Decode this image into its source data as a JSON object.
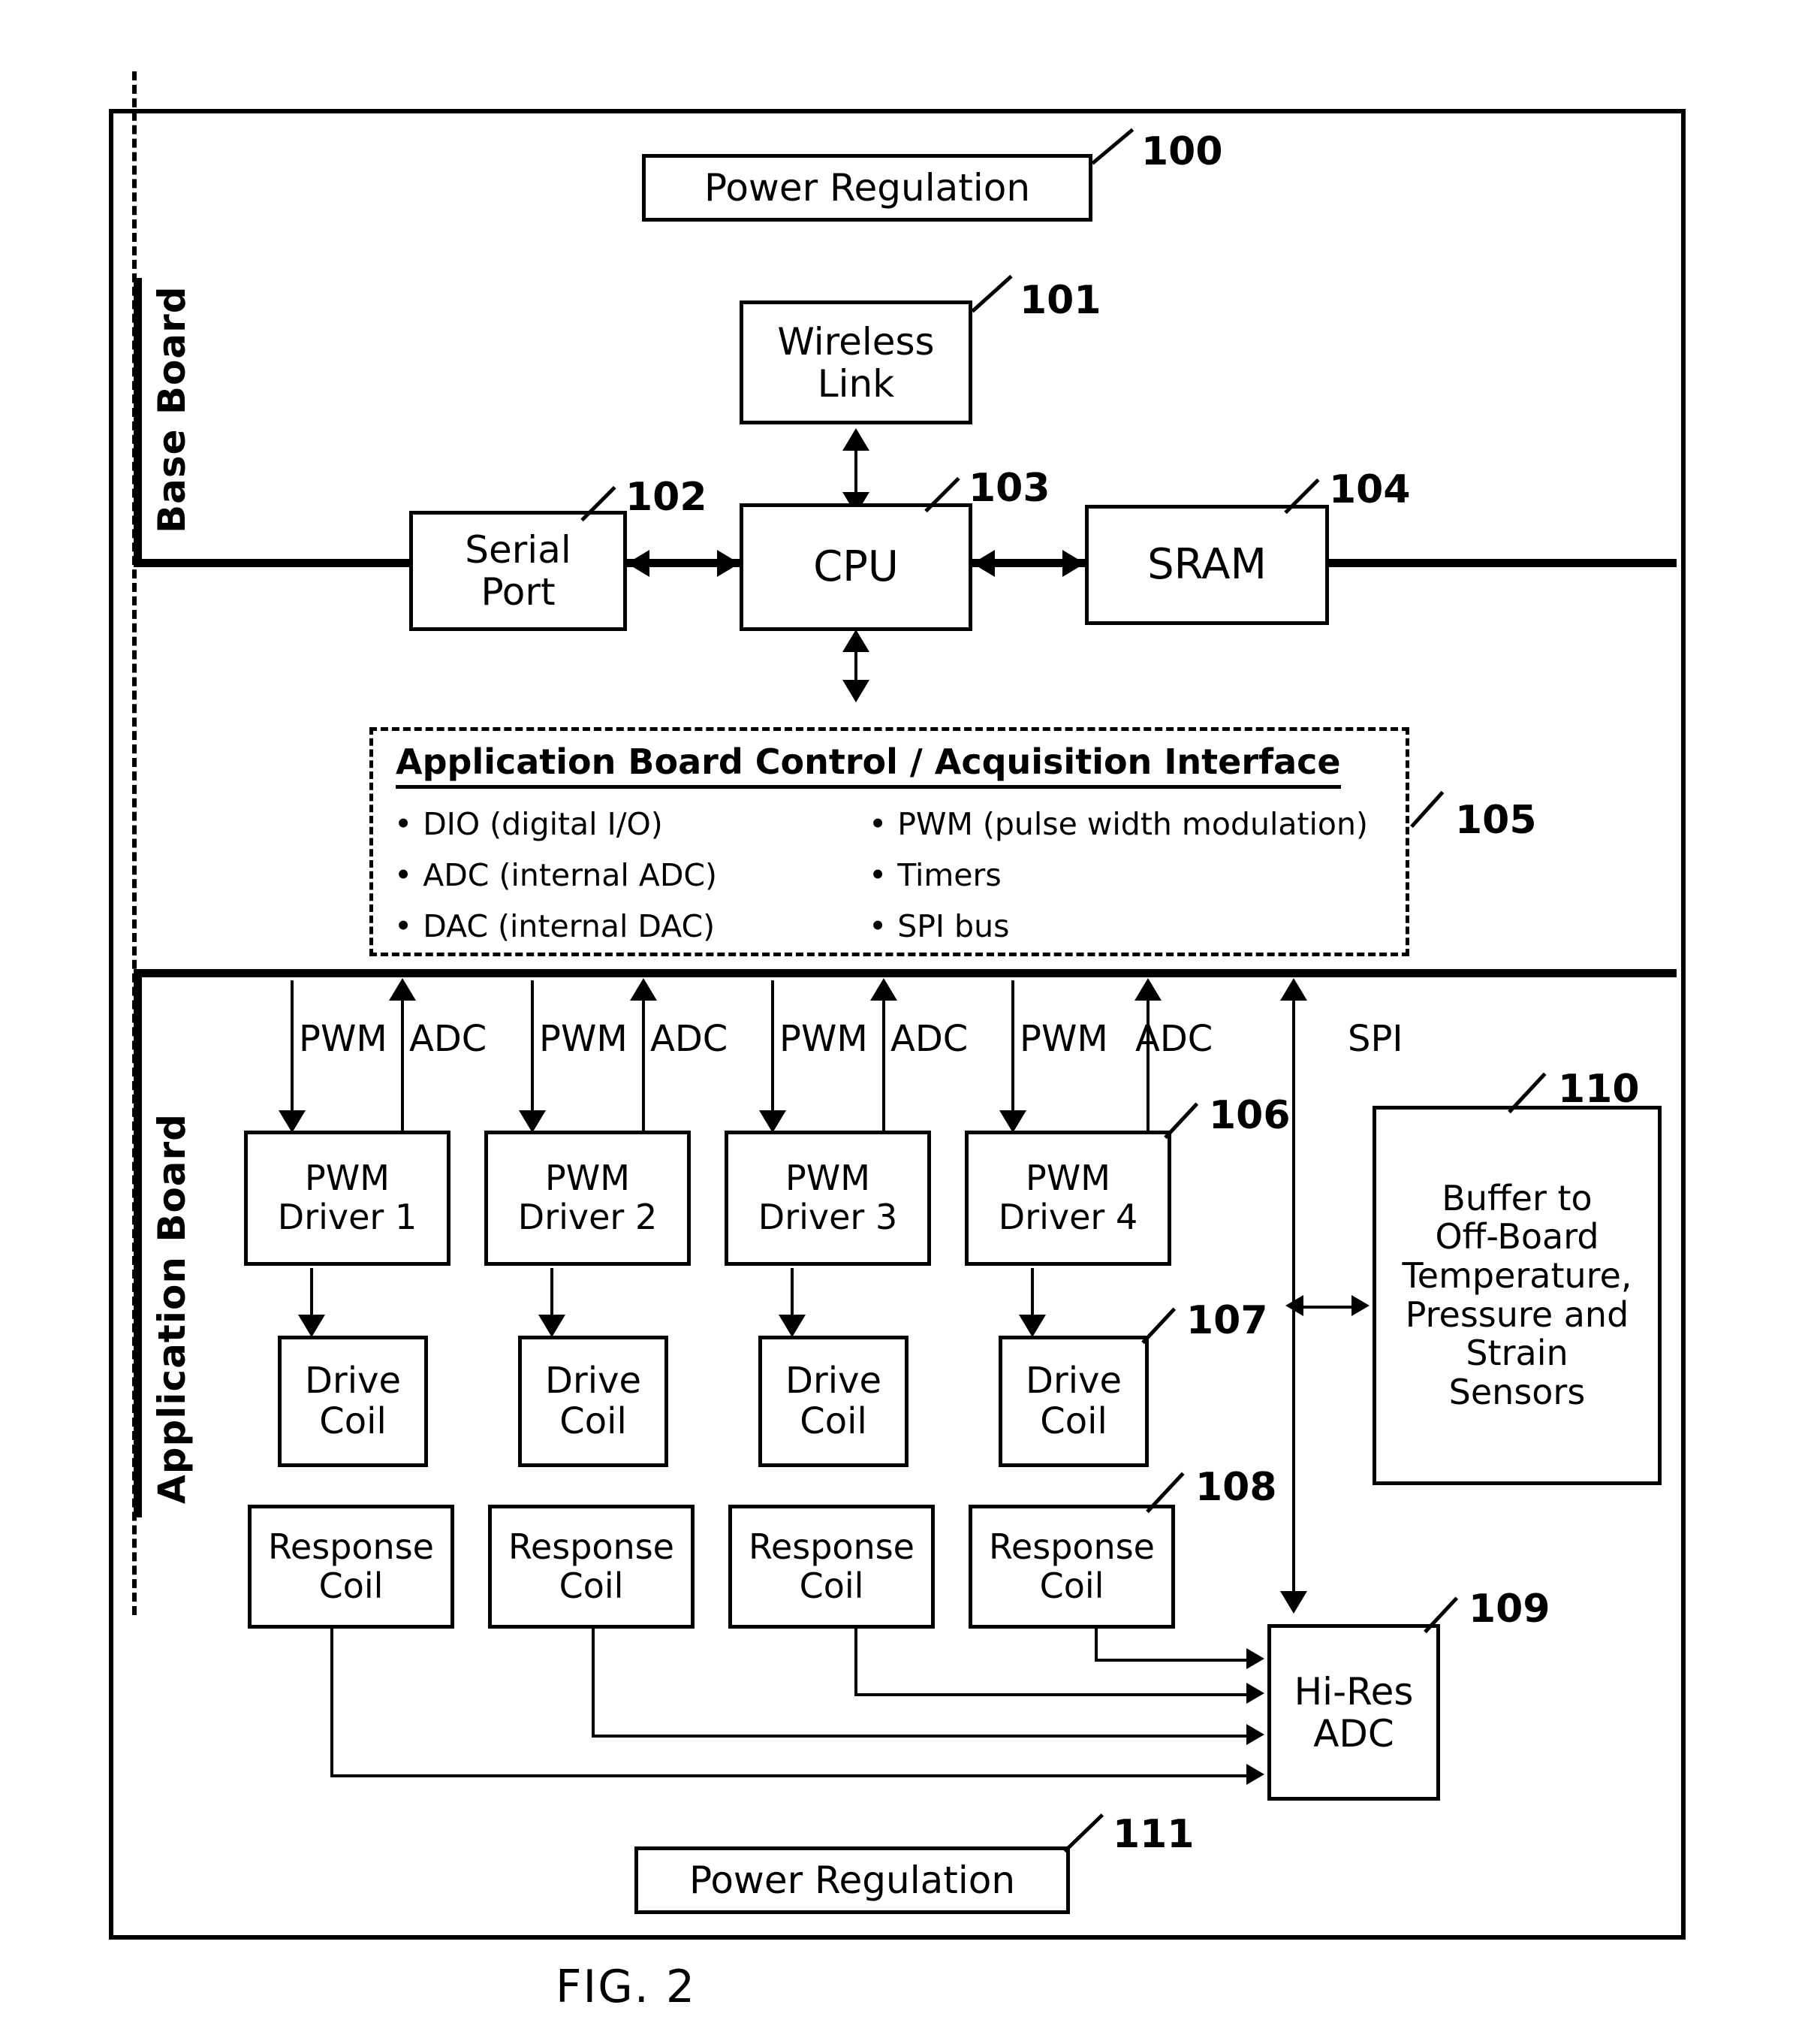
{
  "figure": {
    "caption": "FIG. 2"
  },
  "sections": {
    "base_board": "Base Board",
    "application_board": "Application Board"
  },
  "base_board_blocks": {
    "power_regulation": {
      "label": "Power Regulation",
      "ref": "100"
    },
    "wireless_link": {
      "line1": "Wireless",
      "line2": "Link",
      "ref": "101"
    },
    "serial_port": {
      "line1": "Serial",
      "line2": "Port",
      "ref": "102"
    },
    "cpu": {
      "label": "CPU",
      "ref": "103"
    },
    "sram": {
      "label": "SRAM",
      "ref": "104"
    }
  },
  "interface": {
    "title": "Application Board Control / Acquisition Interface",
    "ref": "105",
    "left_items": [
      "DIO (digital I/O)",
      "ADC (internal ADC)",
      "DAC (internal DAC)"
    ],
    "right_items": [
      "PWM (pulse width modulation)",
      "Timers",
      "SPI bus"
    ]
  },
  "bus_labels": {
    "pwm": "PWM",
    "adc": "ADC",
    "spi": "SPI"
  },
  "application_board_blocks": {
    "pwm_drivers": [
      {
        "line1": "PWM",
        "line2": "Driver 1"
      },
      {
        "line1": "PWM",
        "line2": "Driver 2"
      },
      {
        "line1": "PWM",
        "line2": "Driver 3"
      },
      {
        "line1": "PWM",
        "line2": "Driver 4"
      }
    ],
    "pwm_driver_ref": "106",
    "drive_coil": {
      "line1": "Drive",
      "line2": "Coil"
    },
    "drive_coil_ref": "107",
    "response_coil": {
      "line1": "Response",
      "line2": "Coil"
    },
    "response_coil_ref": "108",
    "hires_adc": {
      "line1": "Hi-Res",
      "line2": "ADC",
      "ref": "109"
    },
    "buffer": {
      "lines": [
        "Buffer to",
        "Off-Board",
        "Temperature,",
        "Pressure and",
        "Strain",
        "Sensors"
      ],
      "ref": "110"
    },
    "power_regulation": {
      "label": "Power Regulation",
      "ref": "111"
    }
  }
}
